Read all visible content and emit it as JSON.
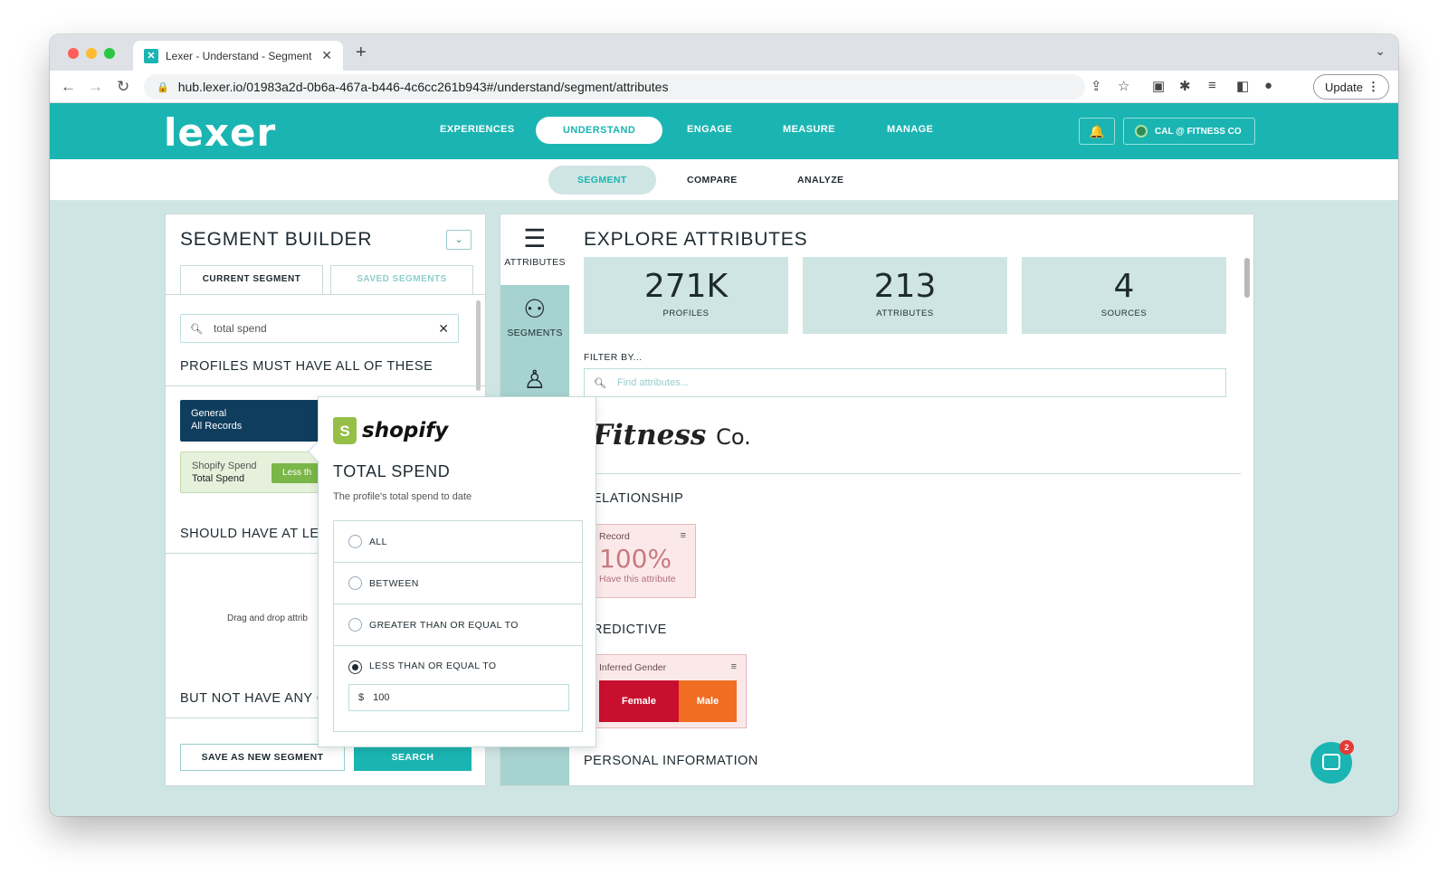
{
  "browser": {
    "tab_title": "Lexer - Understand - Segment",
    "tab_icon": "lexer-favicon",
    "url": "hub.lexer.io/01983a2d-0b6a-467a-b446-4c6cc261b943#/understand/segment/attributes",
    "update_label": "Update"
  },
  "app": {
    "logo": "lexer",
    "nav": [
      "EXPERIENCES",
      "UNDERSTAND",
      "ENGAGE",
      "MEASURE",
      "MANAGE"
    ],
    "active_nav": "UNDERSTAND",
    "account": "CAL @ FITNESS CO"
  },
  "subnav": {
    "items": [
      "SEGMENT",
      "COMPARE",
      "ANALYZE"
    ],
    "active": "SEGMENT"
  },
  "segment_builder": {
    "title": "SEGMENT BUILDER",
    "tabs": [
      "CURRENT SEGMENT",
      "SAVED SEGMENTS"
    ],
    "search_value": "total spend",
    "must_have": "PROFILES MUST HAVE ALL OF THESE",
    "chip_general_1": "General",
    "chip_general_2": "All Records",
    "chip_shopify_1": "Shopify Spend",
    "chip_shopify_2": "Total Spend",
    "chip_shopify_cond": "Less th",
    "should_have": "SHOULD HAVE AT LEA",
    "drag_text": "Drag and drop attrib",
    "not_have": "BUT NOT HAVE ANY O",
    "save_button": "SAVE AS NEW SEGMENT",
    "search_button": "SEARCH"
  },
  "explore": {
    "title": "EXPLORE ATTRIBUTES",
    "sidebar": [
      {
        "label": "ATTRIBUTES",
        "icon": "list-icon"
      },
      {
        "label": "SEGMENTS",
        "icon": "segments-icon"
      },
      {
        "label": "",
        "icon": "person-icon"
      }
    ],
    "stats": [
      {
        "value": "271K",
        "label": "PROFILES"
      },
      {
        "value": "213",
        "label": "ATTRIBUTES"
      },
      {
        "value": "4",
        "label": "SOURCES"
      }
    ],
    "filter_label": "FILTER BY...",
    "filter_placeholder": "Find attributes...",
    "brand_main": "Fitness",
    "brand_suffix": "Co.",
    "groups": [
      "ELATIONSHIP",
      "REDICTIVE",
      "PERSONAL INFORMATION"
    ],
    "record_card": {
      "title": "Record",
      "value": "100%",
      "sub": "Have this attribute"
    },
    "gender_card": {
      "title": "Inferred Gender",
      "female": "Female",
      "male": "Male"
    }
  },
  "popover": {
    "brand": "shopify",
    "title": "TOTAL SPEND",
    "description": "The profile's total spend to date",
    "options": [
      "ALL",
      "BETWEEN",
      "GREATER THAN OR EQUAL TO",
      "LESS THAN OR EQUAL TO"
    ],
    "selected": "LESS THAN OR EQUAL TO",
    "currency": "$",
    "amount": "100"
  },
  "chat": {
    "badge": "2"
  },
  "colors": {
    "teal": "#1ab5b2",
    "navy": "#0e3d5e",
    "shopify_green": "#95bf47",
    "female": "#c8102e",
    "male": "#f06d22"
  }
}
